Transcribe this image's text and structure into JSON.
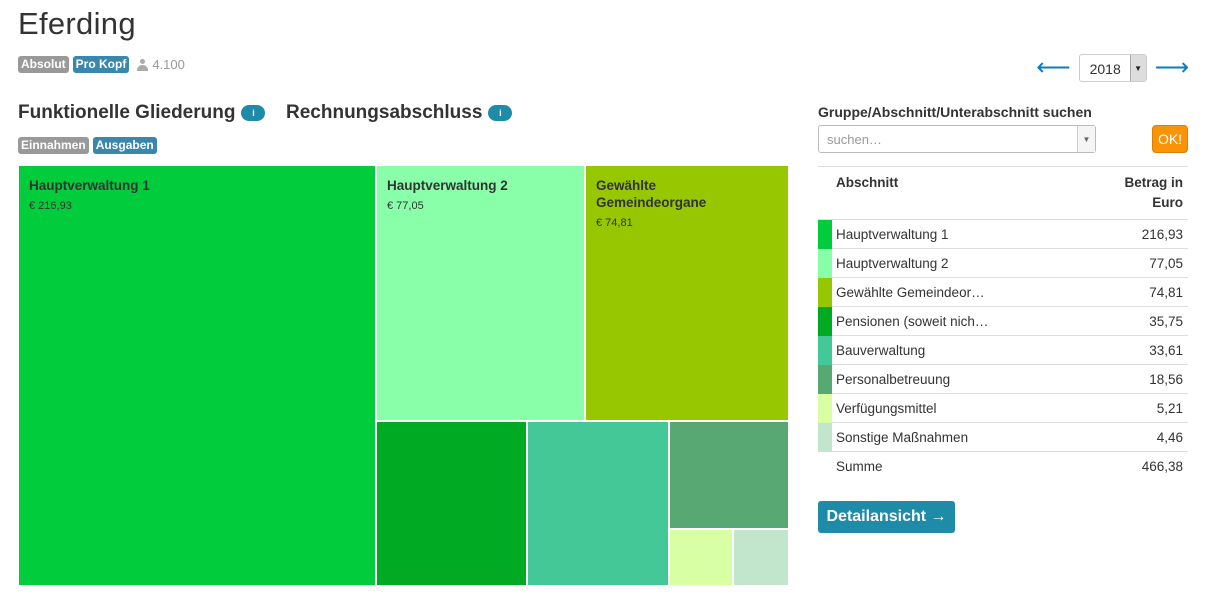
{
  "header": {
    "title": "Eferding",
    "badge_absolut": "Absolut",
    "badge_prokopf": "Pro Kopf",
    "population": "4.100",
    "year": "2018",
    "prev_arrow": "⟵",
    "next_arrow": "⟶"
  },
  "sections": {
    "funktionelle": "Funktionelle Gliederung",
    "rechnung": "Rechnungsabschluss",
    "info_glyph": "i",
    "tab_einnahmen": "Einnahmen",
    "tab_ausgaben": "Ausgaben"
  },
  "treemap": {
    "cells": [
      {
        "name": "Hauptverwaltung 1",
        "amount": "€ 216,93",
        "value": 216.93,
        "color": "#00cc3c"
      },
      {
        "name": "Hauptverwaltung 2",
        "amount": "€ 77,05",
        "value": 77.05,
        "color": "#88ffa8"
      },
      {
        "name": "Gewählte Gemeindeorgane",
        "amount": "€ 74,81",
        "value": 74.81,
        "color": "#97c700"
      },
      {
        "name": "Pensionen (soweit nich…",
        "amount": "",
        "value": 35.75,
        "color": "#00aa22"
      },
      {
        "name": "Bauverwaltung",
        "amount": "",
        "value": 33.61,
        "color": "#44c897"
      },
      {
        "name": "Personalbetreuung",
        "amount": "",
        "value": 18.56,
        "color": "#58a874"
      },
      {
        "name": "Verfügungsmittel",
        "amount": "",
        "value": 5.21,
        "color": "#d8ffa4"
      },
      {
        "name": "Sonstige Maßnahmen",
        "amount": "",
        "value": 4.46,
        "color": "#c2e6cc"
      }
    ]
  },
  "search": {
    "label": "Gruppe/Abschnitt/Unterabschnitt suchen",
    "placeholder": "suchen…",
    "ok": "OK!"
  },
  "table": {
    "col_abschnitt": "Abschnitt",
    "col_betrag": "Betrag in Euro",
    "rows": [
      {
        "label": "Hauptverwaltung 1",
        "value": "216,93",
        "color": "#00cc3c"
      },
      {
        "label": "Hauptverwaltung 2",
        "value": "77,05",
        "color": "#88ffa8"
      },
      {
        "label": "Gewählte Gemeindeor…",
        "value": "74,81",
        "color": "#97c700"
      },
      {
        "label": "Pensionen (soweit nich…",
        "value": "35,75",
        "color": "#00aa22"
      },
      {
        "label": "Bauverwaltung",
        "value": "33,61",
        "color": "#44c897"
      },
      {
        "label": "Personalbetreuung",
        "value": "18,56",
        "color": "#58a874"
      },
      {
        "label": "Verfügungsmittel",
        "value": "5,21",
        "color": "#d8ffa4"
      },
      {
        "label": "Sonstige Maßnahmen",
        "value": "4,46",
        "color": "#c2e6cc"
      }
    ],
    "sum_label": "Summe",
    "sum_value": "466,38"
  },
  "detail_button": "Detailansicht →"
}
